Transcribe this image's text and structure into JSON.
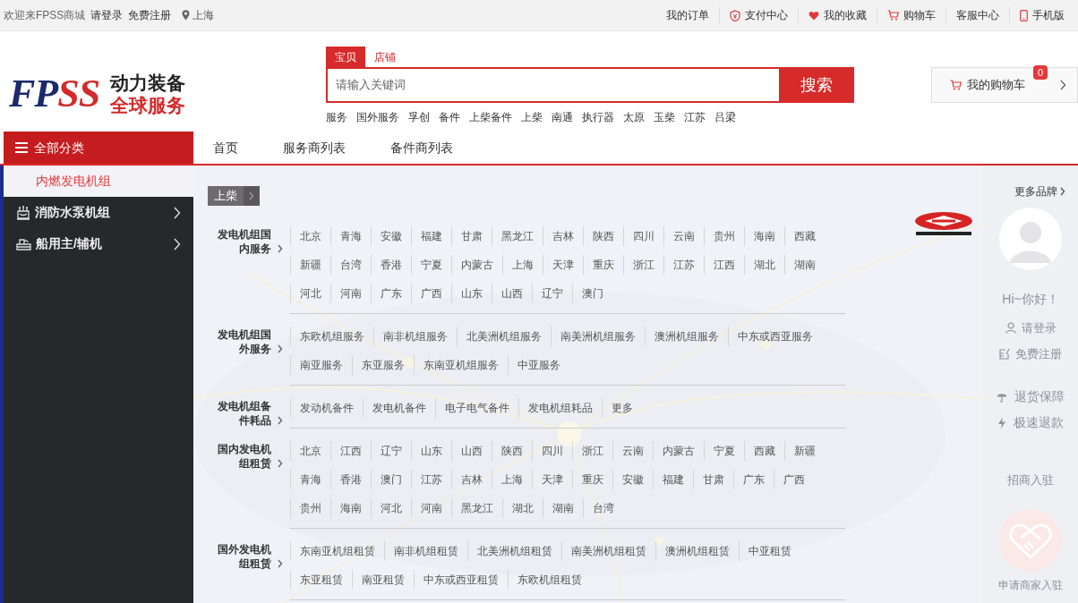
{
  "top_bar": {
    "welcome": "欢迎来FPSS商城",
    "login": "请登录",
    "register": "免费注册",
    "city": "上海",
    "links": [
      {
        "label": "我的订单",
        "kind": "plain"
      },
      {
        "label": "支付中心",
        "kind": "shield"
      },
      {
        "label": "我的收藏",
        "kind": "heart"
      },
      {
        "label": "购物车",
        "kind": "cart"
      },
      {
        "label": "客服中心",
        "kind": "plain"
      },
      {
        "label": "手机版",
        "kind": "phone"
      }
    ]
  },
  "logo": {
    "mark_parts": [
      {
        "text": "FP",
        "color": "#1b2a6b"
      },
      {
        "text": "SS",
        "color": "#d42a2a"
      }
    ],
    "line1": "动力装备",
    "line2": "全球服务"
  },
  "search": {
    "tabs": [
      {
        "label": "宝贝",
        "selected": true
      },
      {
        "label": "店铺",
        "selected": false
      }
    ],
    "placeholder": "请输入关键词",
    "button": "搜索",
    "hot_words": [
      "服务",
      "国外服务",
      "孚创",
      "备件",
      "上柴备件",
      "上柴",
      "南通",
      "执行器",
      "太原",
      "玉柴",
      "江苏",
      "吕梁"
    ]
  },
  "cart": {
    "label": "我的购物车",
    "count": "0"
  },
  "nav": {
    "category_button": "全部分类",
    "items": [
      "首页",
      "服务商列表",
      "备件商列表"
    ]
  },
  "sidebar": {
    "items": [
      {
        "label": "内燃发电机组",
        "selected": true,
        "kind": "plain"
      },
      {
        "label": "消防水泵机组",
        "selected": false,
        "kind": "pump"
      },
      {
        "label": "船用主/辅机",
        "selected": false,
        "kind": "ship"
      }
    ]
  },
  "breadcrumb": {
    "label": "上柴"
  },
  "sections": [
    {
      "title": "发电机组国内服务",
      "links": [
        "北京",
        "青海",
        "安徽",
        "福建",
        "甘肃",
        "黑龙江",
        "吉林",
        "陕西",
        "四川",
        "云南",
        "贵州",
        "海南",
        "西藏",
        "新疆",
        "台湾",
        "香港",
        "宁夏",
        "内蒙古",
        "上海",
        "天津",
        "重庆",
        "浙江",
        "江苏",
        "江西",
        "湖北",
        "湖南",
        "河北",
        "河南",
        "广东",
        "广西",
        "山东",
        "山西",
        "辽宁",
        "澳门"
      ]
    },
    {
      "title": "发电机组国外服务",
      "links": [
        "东欧机组服务",
        "南非机组服务",
        "北美洲机组服务",
        "南美洲机组服务",
        "澳洲机组服务",
        "中东或西亚服务",
        "南亚服务",
        "东亚服务",
        "东南亚机组服务",
        "中亚服务"
      ]
    },
    {
      "title": "发电机组备件耗品",
      "links": [
        "发动机备件",
        "发电机备件",
        "电子电气备件",
        "发电机组耗品",
        "更多"
      ]
    },
    {
      "title": "国内发电机组租赁",
      "links": [
        "北京",
        "江西",
        "辽宁",
        "山东",
        "山西",
        "陕西",
        "四川",
        "浙江",
        "云南",
        "内蒙古",
        "宁夏",
        "西藏",
        "新疆",
        "青海",
        "香港",
        "澳门",
        "江苏",
        "吉林",
        "上海",
        "天津",
        "重庆",
        "安徽",
        "福建",
        "甘肃",
        "广东",
        "广西",
        "贵州",
        "海南",
        "河北",
        "河南",
        "黑龙江",
        "湖北",
        "湖南",
        "台湾"
      ]
    },
    {
      "title": "国外发电机组租赁",
      "links": [
        "东南亚机组租赁",
        "南非机组租赁",
        "北美洲机组租赁",
        "南美洲机组租赁",
        "澳洲机组租赁",
        "中亚租赁",
        "东亚租赁",
        "南亚租赁",
        "中东或西亚租赁",
        "东欧机组租赁"
      ]
    }
  ],
  "right_panel": {
    "more_brands": "更多品牌",
    "greeting": "Hi~你好！",
    "account_links": [
      {
        "label": "请登录",
        "kind": "user"
      },
      {
        "label": "免费注册",
        "kind": "edit"
      }
    ],
    "guarantees": [
      {
        "label": "退货保障",
        "kind": "umbrella"
      },
      {
        "label": "极速退款",
        "kind": "bolt"
      }
    ],
    "merchant_title": "招商入驻",
    "merchant_button": "申请商家入驻"
  }
}
